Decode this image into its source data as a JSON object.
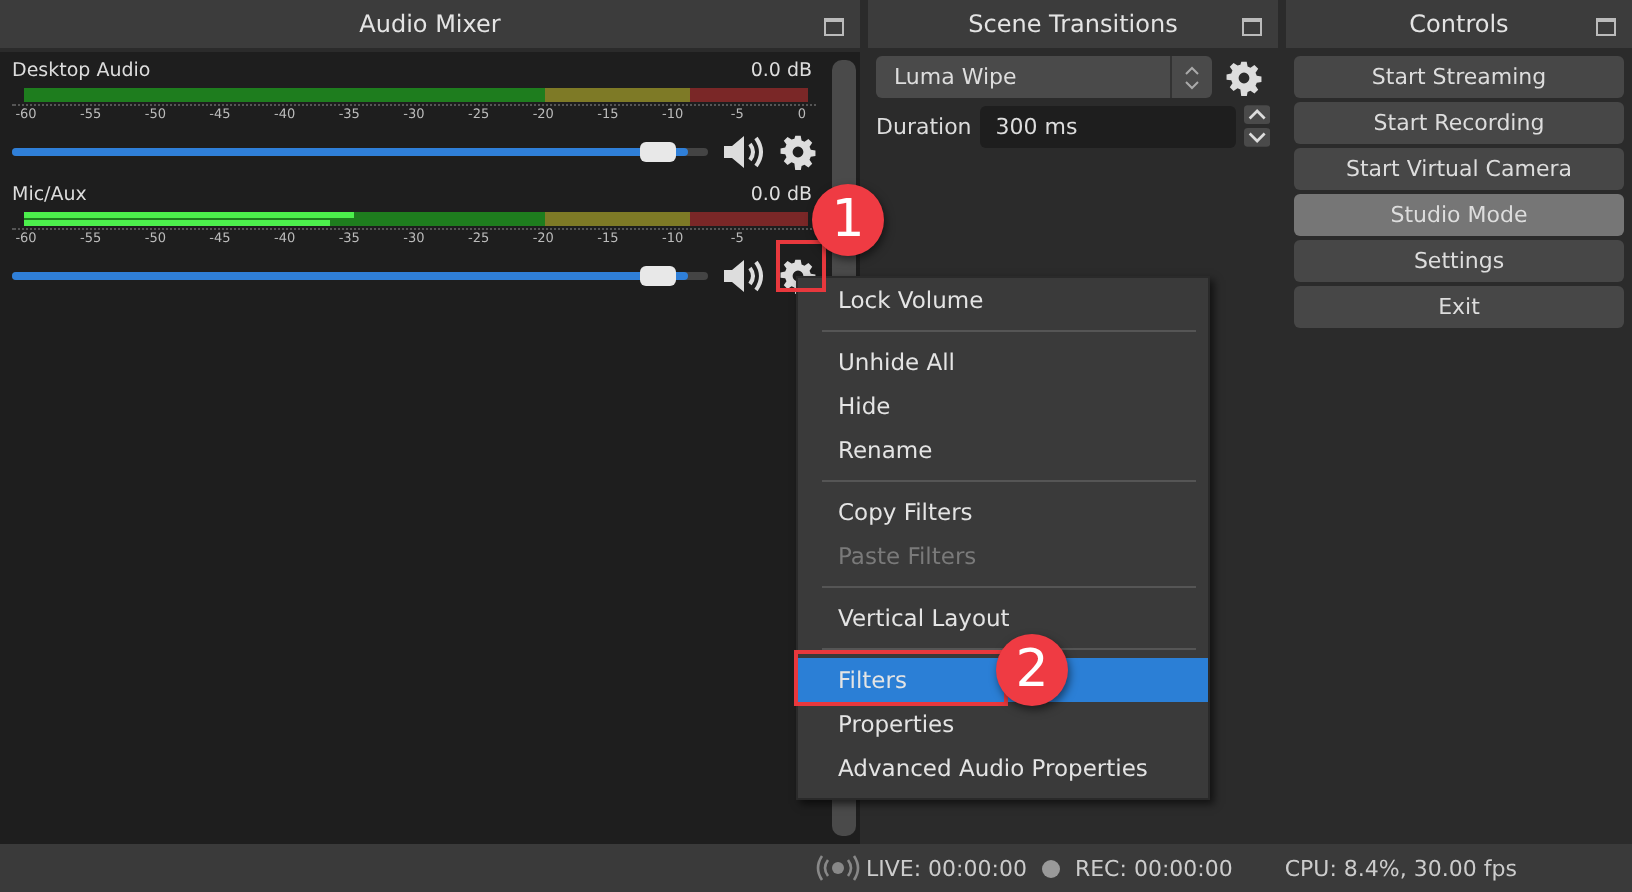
{
  "audio_mixer": {
    "title": "Audio Mixer",
    "channels": [
      {
        "name": "Desktop Audio",
        "reading": "0.0 dB",
        "scale": [
          "-60",
          "-55",
          "-50",
          "-45",
          "-40",
          "-35",
          "-30",
          "-25",
          "-20",
          "-15",
          "-10",
          "-5",
          "0"
        ],
        "level": 0.97
      },
      {
        "name": "Mic/Aux",
        "reading": "0.0 dB",
        "peaks": [
          {
            "level": 0.42
          },
          {
            "level": 0.39
          }
        ],
        "scale": [
          "-60",
          "-55",
          "-50",
          "-45",
          "-40",
          "-35",
          "-30",
          "-25",
          "-20",
          "-15",
          "-10",
          "-5"
        ],
        "level": 0.97
      }
    ]
  },
  "scene_transitions": {
    "title": "Scene Transitions",
    "transition": "Luma Wipe",
    "duration_label": "Duration",
    "duration": "300 ms"
  },
  "controls": {
    "title": "Controls",
    "buttons": [
      {
        "label": "Start Streaming",
        "checked": false
      },
      {
        "label": "Start Recording",
        "checked": false
      },
      {
        "label": "Start Virtual Camera",
        "checked": false
      },
      {
        "label": "Studio Mode",
        "checked": true
      },
      {
        "label": "Settings",
        "checked": false
      },
      {
        "label": "Exit",
        "checked": false
      }
    ]
  },
  "context_menu": {
    "items": [
      {
        "kind": "item",
        "label": "Lock Volume",
        "disabled": false,
        "selected": false
      },
      {
        "kind": "separator"
      },
      {
        "kind": "item",
        "label": "Unhide All",
        "disabled": false,
        "selected": false
      },
      {
        "kind": "item",
        "label": "Hide",
        "disabled": false,
        "selected": false
      },
      {
        "kind": "item",
        "label": "Rename",
        "disabled": false,
        "selected": false
      },
      {
        "kind": "separator"
      },
      {
        "kind": "item",
        "label": "Copy Filters",
        "disabled": false,
        "selected": false
      },
      {
        "kind": "item",
        "label": "Paste Filters",
        "disabled": true,
        "selected": false
      },
      {
        "kind": "separator"
      },
      {
        "kind": "item",
        "label": "Vertical Layout",
        "disabled": false,
        "selected": false
      },
      {
        "kind": "separator"
      },
      {
        "kind": "item",
        "label": "Filters",
        "disabled": false,
        "selected": true
      },
      {
        "kind": "item",
        "label": "Properties",
        "disabled": false,
        "selected": false
      },
      {
        "kind": "item",
        "label": "Advanced Audio Properties",
        "disabled": false,
        "selected": false
      }
    ]
  },
  "callouts": [
    {
      "label": "1"
    },
    {
      "label": "2"
    }
  ],
  "status_bar": {
    "live": "LIVE: 00:00:00",
    "rec": "REC: 00:00:00",
    "cpu": "CPU: 8.4%, 30.00 fps"
  }
}
